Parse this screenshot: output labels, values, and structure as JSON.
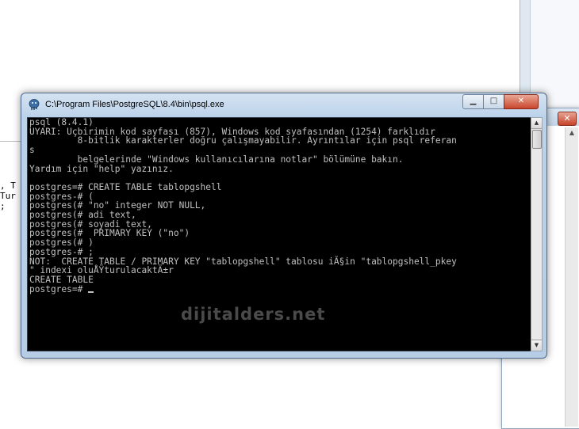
{
  "window": {
    "title": "C:\\Program Files\\PostgreSQL\\8.4\\bin\\psql.exe",
    "minimize_label": "▁",
    "maximize_label": "□",
    "close_label": "✕"
  },
  "console": {
    "lines": [
      "psql (8.4.1)",
      "UYARI: Uçbirimin kod sayfası (857), Windows kod syafasından (1254) farklıdır",
      "         8-bitlik karakterler doğru çalışmayabilir. Ayrıntılar için psql referan",
      "s",
      "         belgelerinde \"Windows kullanıcılarına notlar\" bölümüne bakın.",
      "Yardım için \"help\" yazınız.",
      "",
      "postgres=# CREATE TABLE tablopgshell",
      "postgres-# (",
      "postgres(# \"no\" integer NOT NULL,",
      "postgres(# adi text,",
      "postgres(# soyadi text,",
      "postgres(#  PRIMARY KEY (\"no\")",
      "postgres(# )",
      "postgres-# ;",
      "NOT:  CREATE TABLE / PRIMARY KEY \"tablopgshell\" tablosu iÃ§in \"tablopgshell_pkey",
      "\" indexi oluÅŸturulacaktÄ±r",
      "CREATE TABLE",
      "postgres=# "
    ]
  },
  "watermark": "dijitalders.net",
  "background": {
    "left_text": ", T\nTur\n;"
  }
}
